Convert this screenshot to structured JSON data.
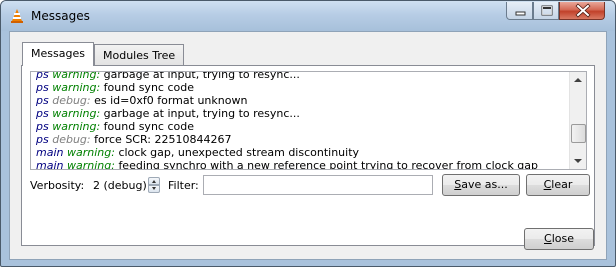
{
  "window": {
    "title": "Messages"
  },
  "tabs": [
    {
      "label": "Messages",
      "active": true
    },
    {
      "label": "Modules Tree",
      "active": false
    }
  ],
  "log": {
    "lines": [
      {
        "module": "ps",
        "level": "warning:",
        "text": "garbage at input, trying to resync..."
      },
      {
        "module": "ps",
        "level": "warning:",
        "text": "found sync code"
      },
      {
        "module": "ps",
        "level": "debug:",
        "text": "es id=0xf0 format unknown"
      },
      {
        "module": "ps",
        "level": "warning:",
        "text": "garbage at input, trying to resync..."
      },
      {
        "module": "ps",
        "level": "warning:",
        "text": "found sync code"
      },
      {
        "module": "ps",
        "level": "debug:",
        "text": "force SCR: 22510844267"
      },
      {
        "module": "main",
        "level": "warning:",
        "text": "clock gap, unexpected stream discontinuity"
      },
      {
        "module": "main",
        "level": "warning:",
        "text": "feeding synchro with a new reference point trying to recover from clock gap"
      }
    ]
  },
  "controls": {
    "verbosity_label": "Verbosity:",
    "verbosity_value": "2 (debug)",
    "filter_label": "Filter:",
    "filter_value": "",
    "save_button": "Save as...",
    "clear_button": "Clear",
    "close_button": "Close"
  },
  "icons": {
    "app": "vlc-cone-icon",
    "minimize": "minimize-icon",
    "maximize": "maximize-icon",
    "close": "close-icon"
  },
  "colors": {
    "module": "#000080",
    "warning": "#008000",
    "debug": "#808080"
  }
}
